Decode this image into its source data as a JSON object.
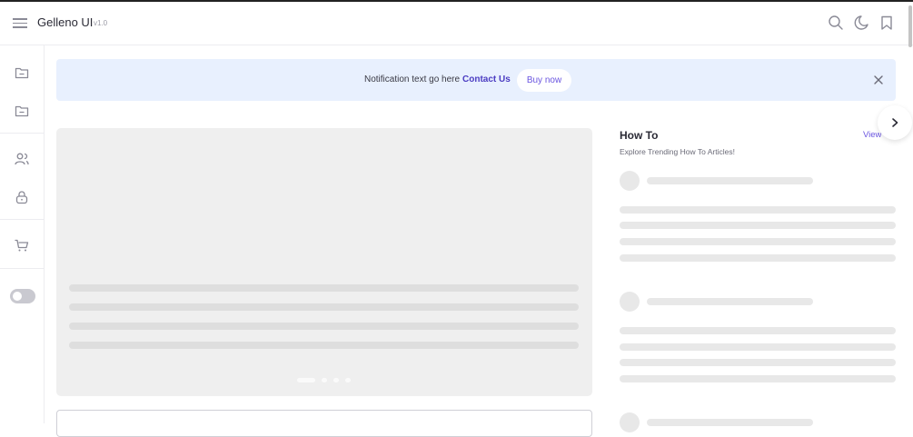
{
  "header": {
    "brand": "Gelleno UI",
    "version": "v1.0",
    "icons": [
      "menu-icon",
      "search-icon",
      "moon-icon",
      "bookmark-icon"
    ]
  },
  "sidebar": {
    "items": [
      {
        "icon": "folder-icon"
      },
      {
        "icon": "folder-icon"
      },
      {
        "icon": "users-icon"
      },
      {
        "icon": "lock-icon"
      },
      {
        "icon": "cart-icon"
      }
    ],
    "toggle_on": false
  },
  "notification": {
    "text": "Notification text go here",
    "link": "Contact Us",
    "button": "Buy now"
  },
  "carousel": {
    "slides": 4,
    "active_slide": 1
  },
  "howto": {
    "title": "How To",
    "subtitle": "Explore Trending How To Articles!",
    "view_label": "View"
  },
  "colors": {
    "accent": "#6a55e0",
    "link": "#4b3cc2",
    "notification_bg": "#e8f0fe",
    "skeleton": "#e8e8e8"
  }
}
